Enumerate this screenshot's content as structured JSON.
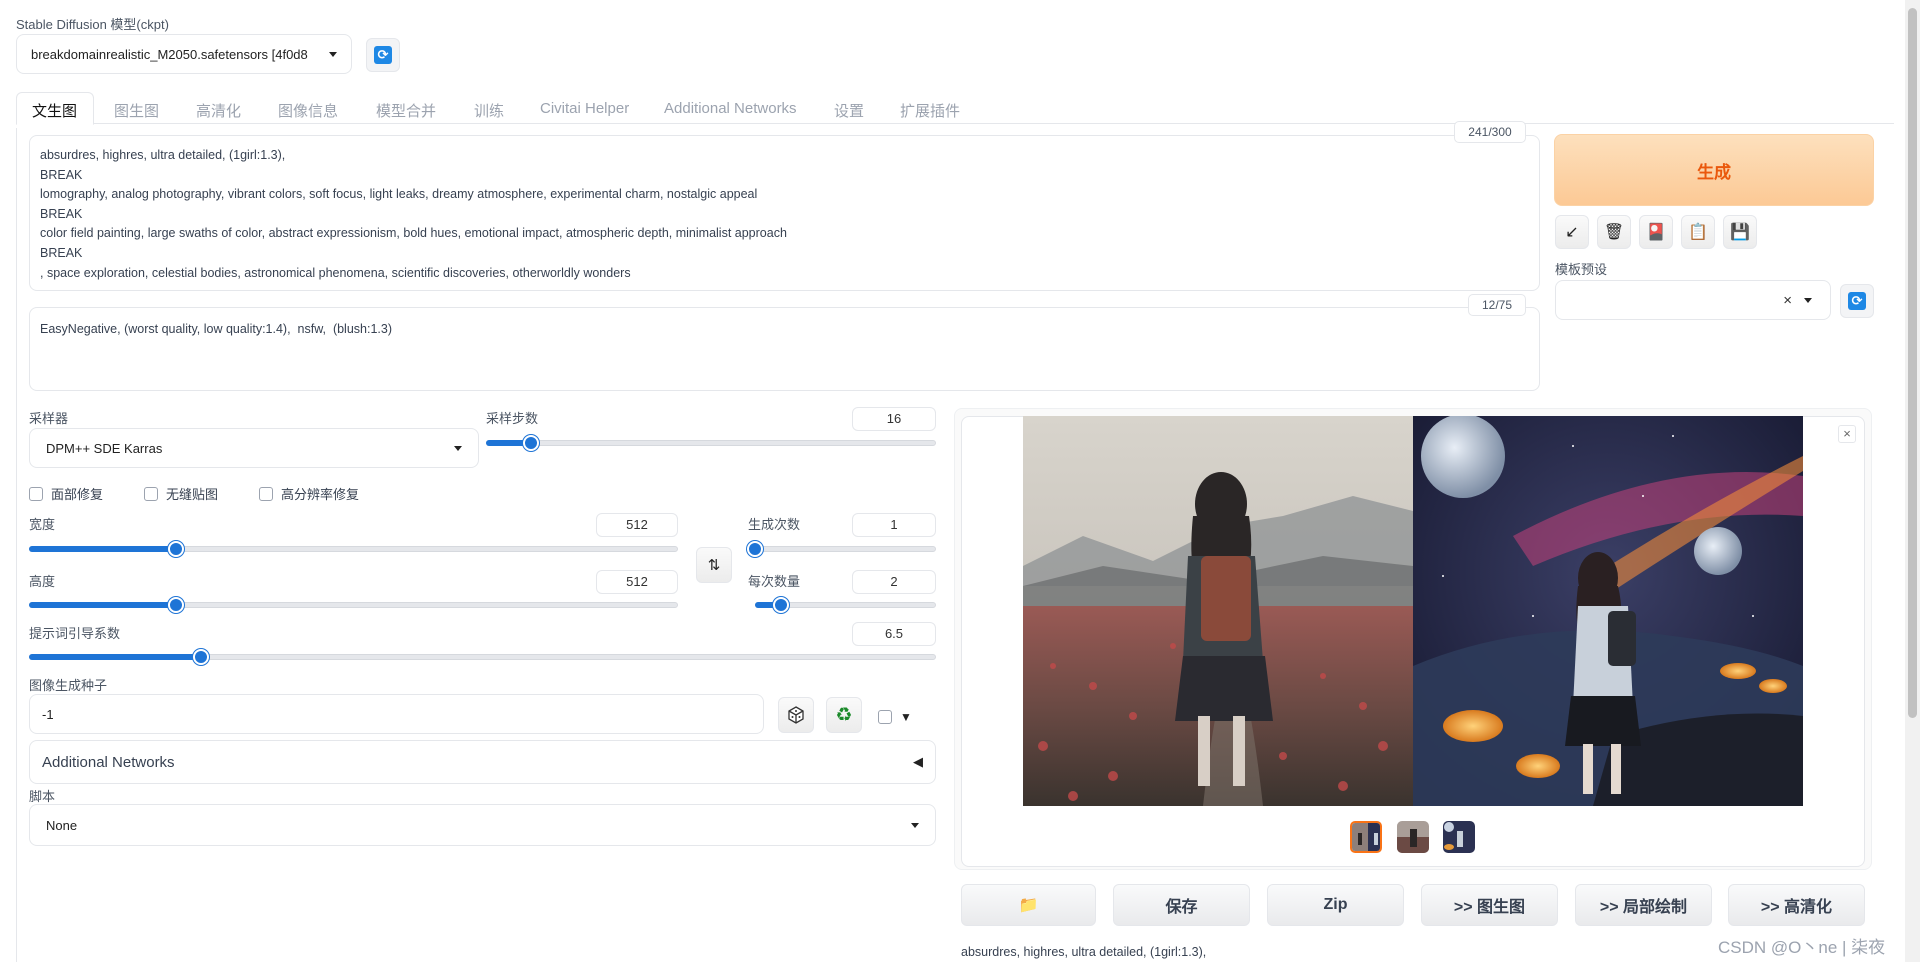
{
  "model": {
    "label": "Stable Diffusion 模型(ckpt)",
    "selected": "breakdomainrealistic_M2050.safetensors [4f0d8"
  },
  "tabs": [
    {
      "label": "文生图",
      "active": true
    },
    {
      "label": "图生图"
    },
    {
      "label": "高清化"
    },
    {
      "label": "图像信息"
    },
    {
      "label": "模型合并"
    },
    {
      "label": "训练"
    },
    {
      "label": "Civitai Helper"
    },
    {
      "label": "Additional Networks"
    },
    {
      "label": "设置"
    },
    {
      "label": "扩展插件"
    }
  ],
  "prompt": {
    "counter": "241/300",
    "lines": [
      "absurdres, highres, ultra detailed, (1girl:1.3),",
      "BREAK",
      "lomography, analog photography, vibrant colors, soft focus, light leaks, dreamy atmosphere, experimental charm, nostalgic appeal",
      "BREAK",
      "color field painting, large swaths of color, abstract expressionism, bold hues, emotional impact, atmospheric depth, minimalist approach",
      "BREAK",
      ", space exploration, celestial bodies, astronomical phenomena, scientific discoveries, otherworldly wonders"
    ]
  },
  "negative": {
    "counter": "12/75",
    "text": "EasyNegative, (worst quality, low quality:1.4),  nsfw,  (blush:1.3)"
  },
  "generate": {
    "label": "生成"
  },
  "tools": {
    "arrow_icon": "↙",
    "trash_icon": "🗑",
    "card_icon": "🎴",
    "clipboard_icon": "📋",
    "save_icon": "💾"
  },
  "styles": {
    "label": "模板预设",
    "clear": "×"
  },
  "sampler": {
    "label": "采样器",
    "value": "DPM++ SDE Karras"
  },
  "steps": {
    "label": "采样步数",
    "value": "16",
    "min": 1,
    "max": 150,
    "current": 16
  },
  "checks": {
    "face": "面部修复",
    "tiling": "无缝贴图",
    "hires": "高分辨率修复"
  },
  "width": {
    "label": "宽度",
    "value": "512",
    "min": 64,
    "max": 2048,
    "current": 512
  },
  "height": {
    "label": "高度",
    "value": "512",
    "min": 64,
    "max": 2048,
    "current": 512
  },
  "batch_count": {
    "label": "生成次数",
    "value": "1",
    "min": 1,
    "max": 100,
    "current": 1
  },
  "batch_size": {
    "label": "每次数量",
    "value": "2",
    "min": 1,
    "max": 8,
    "current": 2
  },
  "cfg": {
    "label": "提示词引导系数",
    "value": "6.5",
    "min": 1,
    "max": 30,
    "current": 6.5
  },
  "seed": {
    "label": "图像生成种子",
    "value": "-1"
  },
  "addnet": {
    "label": "Additional Networks",
    "arrow": "◀"
  },
  "script": {
    "label": "脚本",
    "value": "None"
  },
  "output_buttons": {
    "folder": "📁",
    "save": "保存",
    "zip": "Zip",
    "img2img": ">> 图生图",
    "inpaint": ">> 局部绘制",
    "extras": ">> 高清化"
  },
  "output_info": "absurdres, highres, ultra detailed, (1girl:1.3),",
  "close_icon": "×",
  "watermark": "CSDN @O丶ne | 柒夜",
  "colors": {
    "accent": "#1e74d6",
    "generate_bg": "#fdd5a8",
    "generate_text": "#ea580c"
  }
}
